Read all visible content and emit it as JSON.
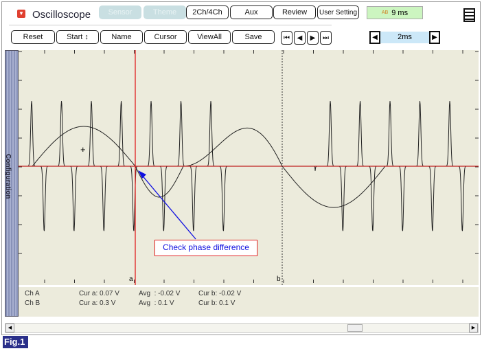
{
  "header": {
    "title": "Oscilloscope",
    "buttons": [
      "Sensor",
      "Theme",
      "2Ch/4Ch",
      "Aux",
      "Review",
      "User Setting"
    ],
    "time_display": "9 ms",
    "time_icon": "ab-icon"
  },
  "toolbar": {
    "buttons": [
      "Reset",
      "Start ↕",
      "Name",
      "Cursor",
      "ViewAll",
      "Save"
    ],
    "nav": [
      "⏮",
      "◀",
      "▶",
      "⏭"
    ],
    "timebase": "2ms"
  },
  "sidebar": {
    "label": "Configuration"
  },
  "cursors": {
    "a": "a",
    "b": "b"
  },
  "annotation": "Check phase difference",
  "readout": [
    {
      "ch": "Ch A",
      "cur_a": "Cur a: 0.07 V",
      "avg": "Avg  : -0.02 V",
      "cur_b": "Cur b: -0.02 V"
    },
    {
      "ch": "Ch B",
      "cur_a": "Cur a: 0.3 V",
      "avg": "Avg  : 0.1 V",
      "cur_b": "Cur b: 0.1 V"
    }
  ],
  "figure_label": "Fig.1",
  "colors": {
    "plot_bg": "#ecebdc",
    "cursor_a": "#e02020",
    "annotation": "#1010e0",
    "highlight": "#ccf5c0",
    "timebase_bg": "#cce8f8"
  }
}
